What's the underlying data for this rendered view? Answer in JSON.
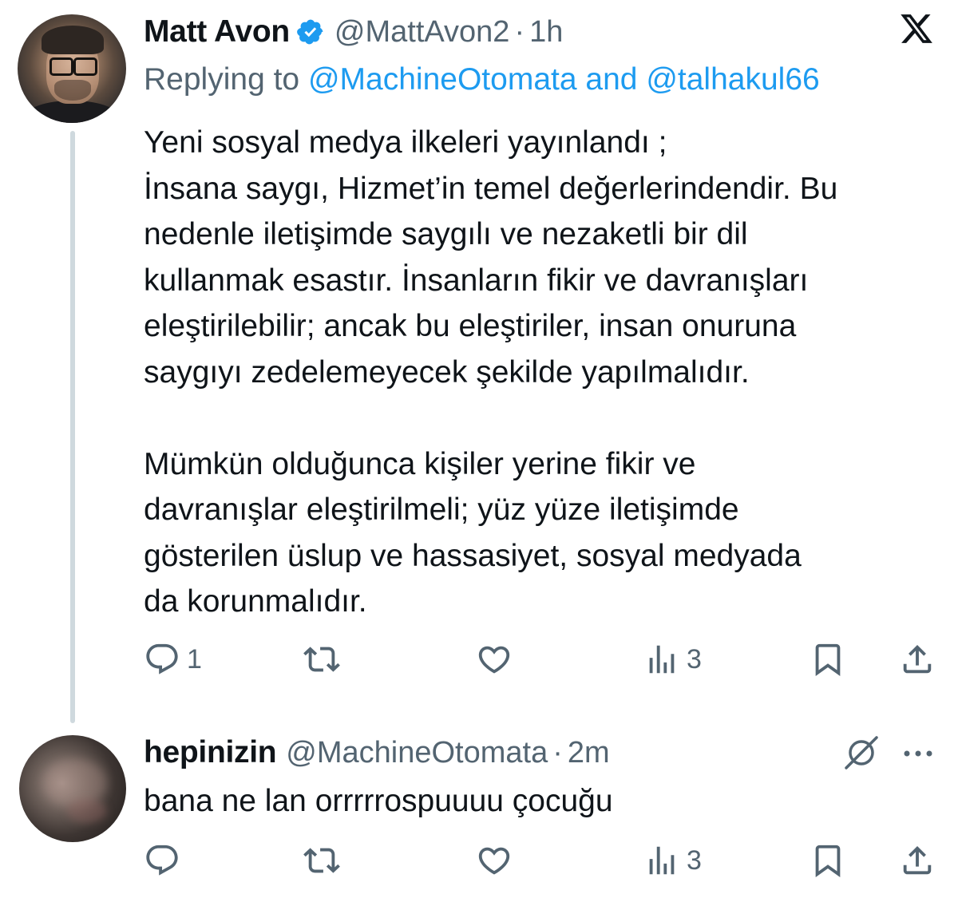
{
  "tweet": {
    "author_name": "Matt Avon",
    "handle": "@MattAvon2",
    "separator": "·",
    "time": "1h",
    "replying_prefix": "Replying to",
    "replying_mention_1": "@MachineOtomata",
    "replying_and": "and",
    "replying_mention_2": "@talhakul66",
    "lines": [
      "Yeni sosyal medya ilkeleri yayınlandı ;",
      "İnsana saygı, Hizmet’in temel değerlerindendir. Bu",
      "nedenle iletişimde saygılı ve nezaketli bir dil",
      "kullanmak esastır. İnsanların fikir ve davranışları",
      "eleştirilebilir; ancak bu eleştiriler, insan onuruna",
      "saygıyı zedelemeyecek şekilde yapılmalıdır.",
      "",
      "Mümkün olduğunca kişiler yerine fikir ve",
      "davranışlar eleştirilmeli; yüz yüze iletişimde",
      "gösterilen üslup ve hassasiyet, sosyal medyada",
      "da korunmalıdır."
    ],
    "reply_count": "1",
    "retweet_count": "",
    "like_count": "",
    "view_count": "3"
  },
  "reply": {
    "author_name": "hepinizin",
    "handle": "@MachineOtomata",
    "separator": "·",
    "time": "2m",
    "text": "bana ne lan orrrrrospuuuu çocuğu",
    "reply_count": "",
    "retweet_count": "",
    "like_count": "",
    "view_count": "3"
  },
  "icons": {
    "brand": "x-logo-icon",
    "verified": "verified-badge-icon",
    "reply": "reply-icon",
    "retweet": "retweet-icon",
    "like": "heart-icon",
    "views": "views-icon",
    "bookmark": "bookmark-icon",
    "share": "share-icon",
    "grok": "grok-icon",
    "more": "more-icon"
  },
  "colors": {
    "text": "#0f1419",
    "secondary": "#536471",
    "accent": "#1d9bf0",
    "thread_line": "#cfd9de"
  }
}
